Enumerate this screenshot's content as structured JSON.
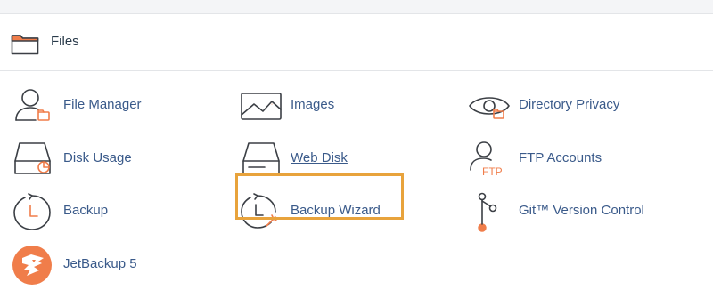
{
  "section": {
    "title": "Files",
    "icon": "folder-icon"
  },
  "items": [
    {
      "label": "File Manager",
      "icon": "file-manager-icon"
    },
    {
      "label": "Images",
      "icon": "images-icon"
    },
    {
      "label": "Directory Privacy",
      "icon": "directory-privacy-icon"
    },
    {
      "label": "Disk Usage",
      "icon": "disk-usage-icon"
    },
    {
      "label": "Web Disk",
      "icon": "web-disk-icon"
    },
    {
      "label": "FTP Accounts",
      "icon": "ftp-accounts-icon",
      "icon_text": "FTP"
    },
    {
      "label": "Backup",
      "icon": "backup-icon"
    },
    {
      "label": "Backup Wizard",
      "icon": "backup-wizard-icon"
    },
    {
      "label": "Git™ Version Control",
      "icon": "git-icon"
    },
    {
      "label": "JetBackup 5",
      "icon": "jetbackup-icon"
    }
  ],
  "colors": {
    "accent_orange": "#f07d4a",
    "link_blue": "#3a5a8a",
    "highlight_border": "#e8a33c"
  }
}
